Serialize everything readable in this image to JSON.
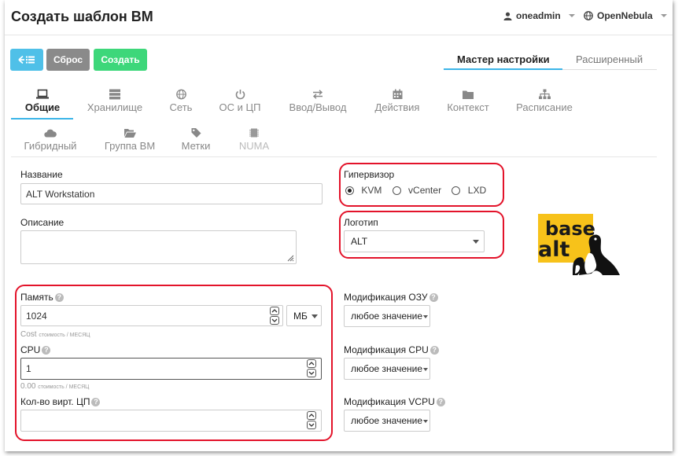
{
  "header": {
    "title": "Создать шаблон ВМ",
    "user": "oneadmin",
    "zone": "OpenNebula"
  },
  "toolbar": {
    "back_icon": "list-back-icon",
    "reset_label": "Сброс",
    "create_label": "Создать"
  },
  "modes": {
    "wizard": "Мастер настройки",
    "advanced": "Расширенный"
  },
  "tabs_row1": [
    {
      "label": "Общие",
      "icon": "laptop-icon"
    },
    {
      "label": "Хранилище",
      "icon": "storage-icon"
    },
    {
      "label": "Сеть",
      "icon": "globe-icon"
    },
    {
      "label": "ОС и ЦП",
      "icon": "power-icon"
    },
    {
      "label": "Ввод/Вывод",
      "icon": "exchange-icon"
    },
    {
      "label": "Действия",
      "icon": "calendar-icon"
    },
    {
      "label": "Контекст",
      "icon": "folder-icon"
    },
    {
      "label": "Расписание",
      "icon": "sitemap-icon"
    }
  ],
  "tabs_row2": [
    {
      "label": "Гибридный",
      "icon": "cloud-icon"
    },
    {
      "label": "Группа ВМ",
      "icon": "folder-open-icon"
    },
    {
      "label": "Метки",
      "icon": "tag-icon"
    },
    {
      "label": "NUMA",
      "icon": "chip-icon"
    }
  ],
  "form": {
    "name_label": "Название",
    "name_value": "ALT Workstation",
    "description_label": "Описание",
    "description_value": "",
    "hypervisor_label": "Гипервизор",
    "hypervisors": [
      "KVM",
      "vCenter",
      "LXD"
    ],
    "logo_label": "Логотип",
    "logo_value": "ALT",
    "memory_label": "Память",
    "memory_value": "1024",
    "memory_unit": "МБ",
    "memory_cost": "Cost",
    "memory_cost_unit": "стоимость / МЕСЯЦ",
    "cpu_label": "CPU",
    "cpu_value": "1",
    "cpu_cost": "0.00",
    "cpu_cost_unit": "стоимость / МЕСЯЦ",
    "vcpu_label": "Кол-во вирт. ЦП",
    "vcpu_value": "",
    "mod_mem_label": "Модификация ОЗУ",
    "mod_cpu_label": "Модификация CPU",
    "mod_vcpu_label": "Модификация VCPU",
    "mod_value": "любое значение"
  },
  "logo": {
    "line1": "base",
    "line2": "alt",
    "bg_color": "#f7c21a"
  },
  "colors": {
    "back": "#4fc0e8",
    "reset": "#8a8a8a",
    "create": "#3dd77a",
    "highlight": "#e3132a",
    "active_tab": "#3bb5e8"
  }
}
